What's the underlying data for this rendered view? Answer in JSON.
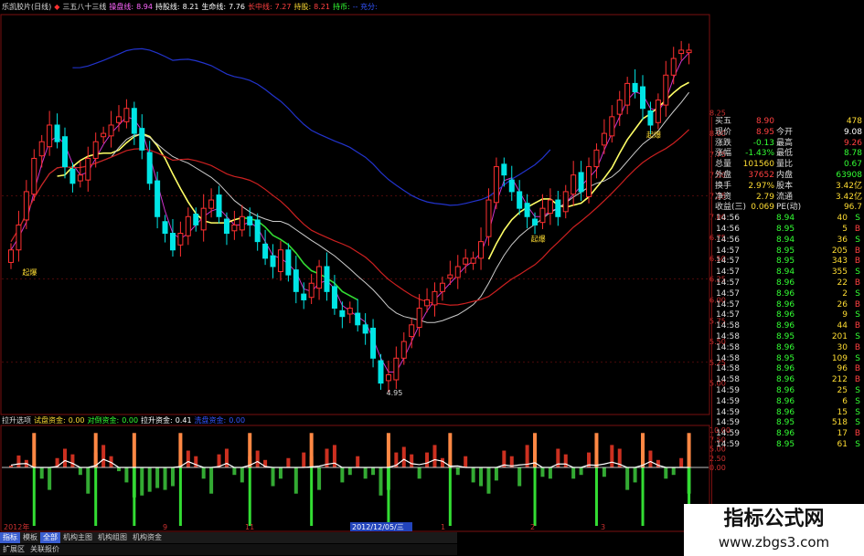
{
  "title_bar": [
    {
      "text": "乐凯胶片(日线)",
      "color": "#dddddd"
    },
    {
      "text": "◆",
      "color": "#ff3030"
    },
    {
      "text": "三五八十三线",
      "color": "#dddddd"
    },
    {
      "text": "操盘线:",
      "color": "#ff66ff"
    },
    {
      "text": "8.94",
      "color": "#ff66ff"
    },
    {
      "text": "持股线:",
      "color": "#ffffff"
    },
    {
      "text": "8.21",
      "color": "#ffffff"
    },
    {
      "text": "生命线:",
      "color": "#ffffff"
    },
    {
      "text": "7.76",
      "color": "#ffffff"
    },
    {
      "text": "长中线:",
      "color": "#ff4040"
    },
    {
      "text": "7.27",
      "color": "#ff4040"
    },
    {
      "text": "持股:",
      "color": "#ffdd33"
    },
    {
      "text": "8.21",
      "color": "#ff4040"
    },
    {
      "text": "持币:",
      "color": "#33ff33"
    },
    {
      "text": "-- 充分:",
      "color": "#3355ff"
    }
  ],
  "sub_legend": [
    {
      "text": "拉升选项",
      "color": "#dddddd"
    },
    {
      "text": "试盘资金:",
      "color": "#ffdd33"
    },
    {
      "text": "0.00",
      "color": "#ffdd33"
    },
    {
      "text": "对倒资金:",
      "color": "#33ff33"
    },
    {
      "text": "0.00",
      "color": "#33ff33"
    },
    {
      "text": "拉升资金:",
      "color": "#ffffff"
    },
    {
      "text": "0.41",
      "color": "#ffffff"
    },
    {
      "text": "洗盘资金:",
      "color": "#3355ff"
    },
    {
      "text": "0.00",
      "color": "#3355ff"
    }
  ],
  "price_axis": [
    "8.25",
    "8.00",
    "7.75",
    "7.50",
    "7.25",
    "7.00",
    "6.75",
    "6.50",
    "6.25",
    "6.00",
    "5.75",
    "5.50",
    "5.25",
    "5.00"
  ],
  "sub_axis": [
    "10.00",
    "7.50",
    "5.00",
    "2.50",
    "0.00"
  ],
  "price_annotations": {
    "low": "4.95",
    "start_labels": [
      "起爆",
      "起爆",
      "起爆"
    ]
  },
  "date_labels": [
    {
      "text": "2012年",
      "active": false
    },
    {
      "text": "9",
      "active": false
    },
    {
      "text": "11",
      "active": false
    },
    {
      "text": "2012/12/05/三",
      "active": true
    },
    {
      "text": "1",
      "active": false
    },
    {
      "text": "2",
      "active": false
    },
    {
      "text": "3",
      "active": false
    }
  ],
  "quote": {
    "top_rows": [
      {
        "label": "买五",
        "value": "8.90",
        "value_color": "#ff4040",
        "value2": "478",
        "value2_color": "#ffdd33"
      },
      {
        "label": "现价",
        "value": "8.95",
        "value_color": "#ff4040",
        "label2": "今开",
        "value2": "9.08",
        "value2_color": "#ffffff"
      },
      {
        "label": "涨跌",
        "value": "-0.13",
        "value_color": "#33ff33",
        "label2": "最高",
        "value2": "9.26",
        "value2_color": "#ff4040"
      },
      {
        "label": "涨幅",
        "value": "-1.43%",
        "value_color": "#33ff33",
        "label2": "最低",
        "value2": "8.78",
        "value2_color": "#33ff33"
      },
      {
        "label": "总量",
        "value": "101560",
        "value_color": "#ffdd33",
        "label2": "量比",
        "value2": "0.67",
        "value2_color": "#33ff33"
      },
      {
        "label": "外盘",
        "value": "37652",
        "value_color": "#ff4040",
        "label2": "内盘",
        "value2": "63908",
        "value2_color": "#33ff33"
      },
      {
        "label": "换手",
        "value": "2.97%",
        "value_color": "#ffdd33",
        "label2": "股本",
        "value2": "3.42亿",
        "value2_color": "#ffdd33"
      },
      {
        "label": "净资",
        "value": "2.79",
        "value_color": "#ffdd33",
        "label2": "流通",
        "value2": "3.42亿",
        "value2_color": "#ffdd33"
      },
      {
        "label": "收益(三)",
        "value": "0.069",
        "value_color": "#ffdd33",
        "label2": "PE(动)",
        "value2": "96.7",
        "value2_color": "#ffdd33"
      }
    ],
    "ticks": [
      {
        "time": "14:56",
        "price": "8.94",
        "vol": "40",
        "side": "S"
      },
      {
        "time": "14:56",
        "price": "8.95",
        "vol": "5",
        "side": "B"
      },
      {
        "time": "14:56",
        "price": "8.94",
        "vol": "36",
        "side": "S"
      },
      {
        "time": "14:57",
        "price": "8.95",
        "vol": "205",
        "side": "B"
      },
      {
        "time": "14:57",
        "price": "8.95",
        "vol": "343",
        "side": "B"
      },
      {
        "time": "14:57",
        "price": "8.94",
        "vol": "355",
        "side": "S"
      },
      {
        "time": "14:57",
        "price": "8.96",
        "vol": "22",
        "side": "B"
      },
      {
        "time": "14:57",
        "price": "8.96",
        "vol": "2",
        "side": "S"
      },
      {
        "time": "14:57",
        "price": "8.96",
        "vol": "26",
        "side": "B"
      },
      {
        "time": "14:57",
        "price": "8.96",
        "vol": "9",
        "side": "S"
      },
      {
        "time": "14:58",
        "price": "8.96",
        "vol": "44",
        "side": "B"
      },
      {
        "time": "14:58",
        "price": "8.95",
        "vol": "201",
        "side": "S"
      },
      {
        "time": "14:58",
        "price": "8.96",
        "vol": "30",
        "side": "B"
      },
      {
        "time": "14:58",
        "price": "8.95",
        "vol": "109",
        "side": "S"
      },
      {
        "time": "14:58",
        "price": "8.96",
        "vol": "96",
        "side": "B"
      },
      {
        "time": "14:58",
        "price": "8.96",
        "vol": "212",
        "side": "B"
      },
      {
        "time": "14:59",
        "price": "8.96",
        "vol": "25",
        "side": "S"
      },
      {
        "time": "14:59",
        "price": "8.96",
        "vol": "6",
        "side": "S"
      },
      {
        "time": "14:59",
        "price": "8.96",
        "vol": "15",
        "side": "S"
      },
      {
        "time": "14:59",
        "price": "8.95",
        "vol": "518",
        "side": "S"
      },
      {
        "time": "14:59",
        "price": "8.96",
        "vol": "17",
        "side": "B"
      },
      {
        "time": "14:59",
        "price": "8.95",
        "vol": "61",
        "side": "S"
      }
    ]
  },
  "tabs_row1": [
    {
      "label": "指标",
      "active": true
    },
    {
      "label": "模板",
      "active": false
    },
    {
      "label": "全部",
      "active": true
    },
    {
      "label": "机构主图",
      "active": false
    },
    {
      "label": "机构组图",
      "active": false
    },
    {
      "label": "机构资金",
      "active": false
    }
  ],
  "tabs_row2": [
    {
      "label": "扩展区"
    },
    {
      "label": "关联报价"
    }
  ],
  "watermark": {
    "main": "指标公式网",
    "url": "www.zbgs3.com"
  },
  "colors": {
    "up": "#ff3030",
    "down": "#00e5e5",
    "grid": "#7a1010",
    "ma_fast": "#cc33cc",
    "ma_yellow": "#ffff66",
    "ma_green": "#33dd33",
    "ma_white": "#cccccc",
    "ma_red": "#cc2020",
    "ma_blue": "#2233cc",
    "vol_up": "#cc3020",
    "vol_down": "#33aa33",
    "tall_bar": "#ff8844"
  },
  "chart_data": {
    "type": "candlestick",
    "price_range": [
      4.95,
      9.26
    ],
    "low_marker": 4.95,
    "closes": [
      6.6,
      6.9,
      7.3,
      7.7,
      7.9,
      8.1,
      7.9,
      7.6,
      7.4,
      7.5,
      7.7,
      7.9,
      8.0,
      8.1,
      8.2,
      8.3,
      8.0,
      7.8,
      7.4,
      7.0,
      6.8,
      6.6,
      6.8,
      7.0,
      6.9,
      7.1,
      7.2,
      7.0,
      6.8,
      6.9,
      7.0,
      6.9,
      6.7,
      6.5,
      6.4,
      6.6,
      6.3,
      6.1,
      6.0,
      6.2,
      6.4,
      6.1,
      5.9,
      5.8,
      5.9,
      5.7,
      5.6,
      5.3,
      5.0,
      5.1,
      5.3,
      5.5,
      5.7,
      5.9,
      6.0,
      6.1,
      6.2,
      6.3,
      6.4,
      6.5,
      6.5,
      6.7,
      7.2,
      7.6,
      7.5,
      7.3,
      7.1,
      7.0,
      6.9,
      7.1,
      7.2,
      7.0,
      7.3,
      7.5,
      7.3,
      7.6,
      7.8,
      8.0,
      8.2,
      8.4,
      8.6,
      8.5,
      8.3,
      8.1,
      8.4,
      8.7,
      8.9,
      9.0,
      9.0
    ],
    "sub_values": [
      0.5,
      3.2,
      2.0,
      1.0,
      -3.0,
      -6.0,
      2.5,
      5.0,
      3.5,
      -2.0,
      -7.0,
      4.0,
      6.0,
      3.0,
      -1.0,
      -4.0,
      -8.0,
      -7.5,
      -6.5,
      -5.5,
      -6.0,
      -5.0,
      2.0,
      4.5,
      3.0,
      -3.0,
      -7.0,
      3.5,
      5.0,
      -2.0,
      -4.0,
      3.0,
      4.5,
      2.0,
      -5.0,
      -3.0,
      2.5,
      -7.0,
      4.0,
      3.0,
      -6.0,
      5.0,
      6.0,
      -4.0,
      -2.0,
      3.0,
      -3.0,
      -2.0,
      -7.5,
      -6.0,
      4.0,
      5.5,
      3.5,
      -3.0,
      4.0,
      6.0,
      2.5,
      1.5,
      -2.0,
      3.0,
      -4.0,
      -5.0,
      -7.0,
      -3.5,
      4.5,
      3.0,
      -5.0,
      6.0,
      4.0,
      -2.5,
      -3.0,
      5.0,
      3.5,
      -3.0,
      -2.0,
      4.0,
      2.0,
      -2.5,
      6.0,
      5.0,
      -6.0,
      -4.0,
      3.0,
      4.5,
      2.0,
      -3.0,
      -2.0,
      2.5,
      -7.0
    ],
    "tall_markers": [
      3,
      11,
      16,
      22,
      31,
      39,
      49,
      57,
      68,
      76,
      82,
      88
    ]
  }
}
